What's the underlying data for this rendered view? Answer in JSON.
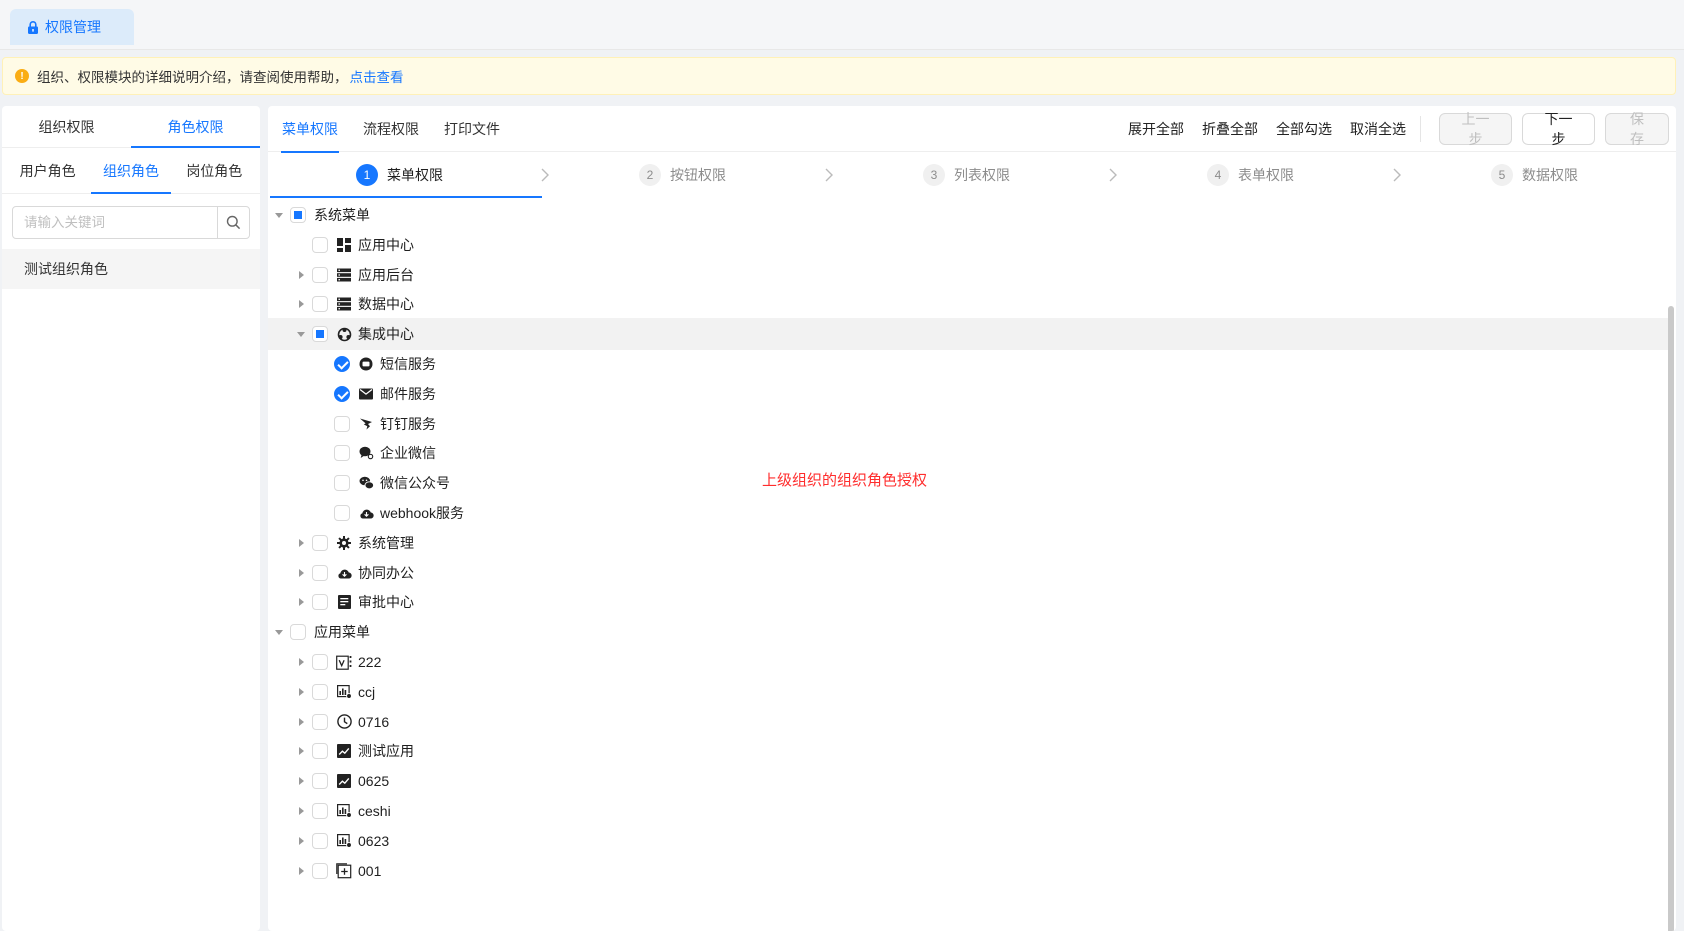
{
  "page_tab": {
    "label": "权限管理"
  },
  "notice": {
    "text": "组织、权限模块的详细说明介绍，请查阅使用帮助，",
    "link": "点击查看"
  },
  "left": {
    "tabs": [
      "组织权限",
      "角色权限"
    ],
    "sub_tabs": [
      "用户角色",
      "组织角色",
      "岗位角色"
    ],
    "search_placeholder": "请输入关键词",
    "roles": [
      "测试组织角色"
    ]
  },
  "main": {
    "tabs": [
      "菜单权限",
      "流程权限",
      "打印文件"
    ],
    "actions": [
      "展开全部",
      "折叠全部",
      "全部勾选",
      "取消全选"
    ],
    "buttons": {
      "prev": "上一步",
      "next": "下一步",
      "save": "保 存"
    },
    "steps": [
      {
        "num": "1",
        "label": "菜单权限"
      },
      {
        "num": "2",
        "label": "按钮权限"
      },
      {
        "num": "3",
        "label": "列表权限"
      },
      {
        "num": "4",
        "label": "表单权限"
      },
      {
        "num": "5",
        "label": "数据权限"
      }
    ],
    "annotation": "上级组织的组织角色授权",
    "tree": [
      {
        "label": "系统菜单",
        "level": 0,
        "expanded": true,
        "state": "indeterminate",
        "icon": "none"
      },
      {
        "label": "应用中心",
        "level": 1,
        "expanded": null,
        "state": "unchecked",
        "icon": "dashboard-icon"
      },
      {
        "label": "应用后台",
        "level": 1,
        "expanded": false,
        "state": "unchecked",
        "icon": "server-icon"
      },
      {
        "label": "数据中心",
        "level": 1,
        "expanded": false,
        "state": "unchecked",
        "icon": "server-icon"
      },
      {
        "label": "集成中心",
        "level": 1,
        "expanded": true,
        "state": "indeterminate",
        "icon": "hub-icon",
        "highlight": true
      },
      {
        "label": "短信服务",
        "level": 2,
        "expanded": null,
        "state": "checked",
        "icon": "message-icon"
      },
      {
        "label": "邮件服务",
        "level": 2,
        "expanded": null,
        "state": "checked",
        "icon": "mail-icon"
      },
      {
        "label": "钉钉服务",
        "level": 2,
        "expanded": null,
        "state": "unchecked",
        "icon": "dingtalk-icon"
      },
      {
        "label": "企业微信",
        "level": 2,
        "expanded": null,
        "state": "unchecked",
        "icon": "wecom-icon"
      },
      {
        "label": "微信公众号",
        "level": 2,
        "expanded": null,
        "state": "unchecked",
        "icon": "wechat-icon"
      },
      {
        "label": "webhook服务",
        "level": 2,
        "expanded": null,
        "state": "unchecked",
        "icon": "cloud-icon"
      },
      {
        "label": "系统管理",
        "level": 1,
        "expanded": false,
        "state": "unchecked",
        "icon": "settings-icon"
      },
      {
        "label": "协同办公",
        "level": 1,
        "expanded": false,
        "state": "unchecked",
        "icon": "cloud-icon"
      },
      {
        "label": "审批中心",
        "level": 1,
        "expanded": false,
        "state": "unchecked",
        "icon": "document-icon"
      },
      {
        "label": "应用菜单",
        "level": 0,
        "expanded": true,
        "state": "unchecked",
        "icon": "none"
      },
      {
        "label": "222",
        "level": 1,
        "expanded": false,
        "state": "unchecked",
        "icon": "form-icon"
      },
      {
        "label": "ccj",
        "level": 1,
        "expanded": false,
        "state": "unchecked",
        "icon": "report-icon"
      },
      {
        "label": "0716",
        "level": 1,
        "expanded": false,
        "state": "unchecked",
        "icon": "clock-icon"
      },
      {
        "label": "测试应用",
        "level": 1,
        "expanded": false,
        "state": "unchecked",
        "icon": "chart-icon"
      },
      {
        "label": "0625",
        "level": 1,
        "expanded": false,
        "state": "unchecked",
        "icon": "chart-icon"
      },
      {
        "label": "ceshi",
        "level": 1,
        "expanded": false,
        "state": "unchecked",
        "icon": "report-icon"
      },
      {
        "label": "0623",
        "level": 1,
        "expanded": false,
        "state": "unchecked",
        "icon": "report-icon"
      },
      {
        "label": "001",
        "level": 1,
        "expanded": false,
        "state": "unchecked",
        "icon": "add-box-icon"
      }
    ]
  },
  "colors": {
    "primary": "#1677ff",
    "warning": "#faad14",
    "annotation": "#ff2d2d"
  }
}
